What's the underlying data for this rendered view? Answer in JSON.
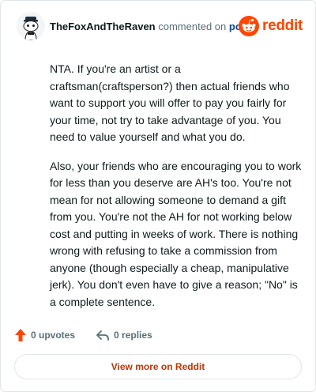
{
  "header": {
    "username": "TheFoxAndTheRaven",
    "commented_on": "commented on",
    "post_link": "post",
    "brand_name": "reddit",
    "avatar_icon": "snoo-avatar-icon",
    "brand_icon": "reddit-snoo-icon"
  },
  "comment": {
    "paragraphs": [
      "NTA. If you're an artist or a craftsman(craftsperson?) then actual friends who want to support you will offer to pay you fairly for your time, not try to take advantage of you. You need to value yourself and what you do.",
      "Also, your friends who are encouraging you to work for less than you deserve are AH's too. You're not mean for not allowing someone to demand a gift from you. You're not the AH for not working below cost and putting in weeks of work. There is nothing wrong with refusing to take a commission from anyone (though especially a cheap, manipulative jerk). You don't even have to give a reason; \"No\" is a complete sentence."
    ]
  },
  "actions": {
    "upvotes": "0 upvotes",
    "replies": "0 replies",
    "upvote_icon": "upvote-arrow-icon",
    "reply_icon": "reply-arrow-icon"
  },
  "footer": {
    "view_more": "View more on Reddit"
  },
  "colors": {
    "brand": "#ff4500",
    "link": "#0a449b",
    "muted": "#576f76",
    "view_more_text": "#c03501",
    "border": "#e3e6e8"
  }
}
